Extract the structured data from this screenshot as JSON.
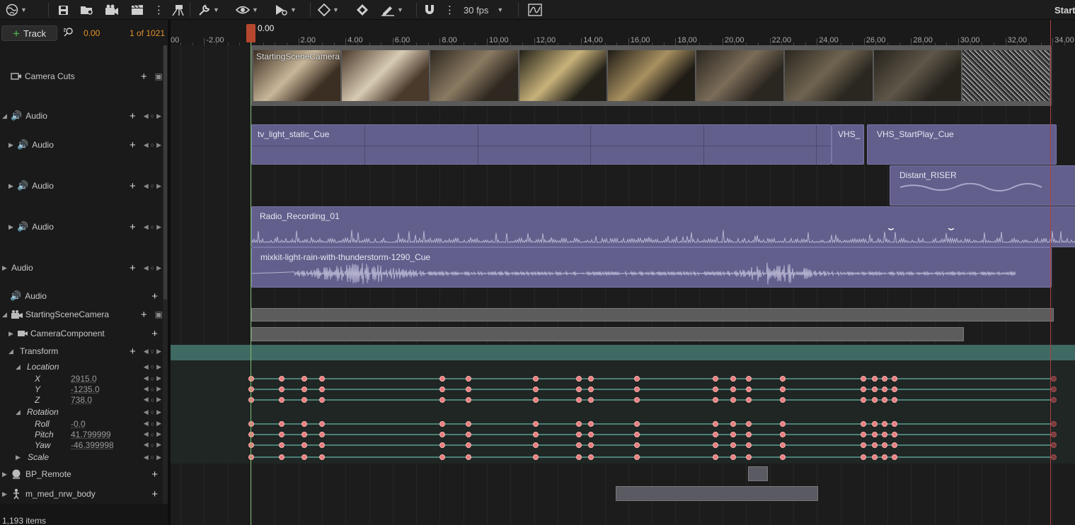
{
  "toolbar": {
    "fps": "30 fps",
    "start_label": "Start"
  },
  "sequencer": {
    "track_button": "Track",
    "current_time": "0.00",
    "frame_counter": "1 of 1021",
    "playhead_time": "0.00",
    "ruler_labels": [
      "00",
      "-2.00",
      "2.00",
      "4.00",
      "6.00",
      "8.00",
      "10.00",
      "12.00",
      "14.00",
      "16.00",
      "18.00",
      "20.00",
      "22.00",
      "24.00",
      "26.00",
      "28.00",
      "30.00",
      "32.00",
      "34.00"
    ]
  },
  "tracks": {
    "camera_cuts": "Camera Cuts",
    "audio_master": "Audio",
    "audio_1": "Audio",
    "audio_2": "Audio",
    "audio_3": "Audio",
    "audio_4": "Audio",
    "audio_5": "Audio",
    "starting_scene_camera": "StartingSceneCamera",
    "camera_component": "CameraComponent",
    "transform": "Transform",
    "location": "Location",
    "x": "X",
    "y": "Y",
    "z": "Z",
    "rotation": "Rotation",
    "roll": "Roll",
    "pitch": "Pitch",
    "yaw": "Yaw",
    "scale": "Scale",
    "bp_remote": "BP_Remote",
    "m_med_nrw_body": "m_med_nrw_body"
  },
  "values": {
    "x": "2915.0",
    "y": "-1235.0",
    "z": "738.0",
    "roll": "-0.0",
    "pitch": "41.799999",
    "yaw": "-46.399998"
  },
  "clips": {
    "camera_shot": "StartingSceneCamera",
    "tv_light": "tv_light_static_Cue",
    "vhs_short": "VHS_",
    "vhs_start": "VHS_StartPlay_Cue",
    "distant_riser": "Distant_RISER",
    "radio": "Radio_Recording_01",
    "rain": "mixkit-light-rain-with-thunderstorm-1290_Cue"
  },
  "status": {
    "items": "1,193 items"
  }
}
